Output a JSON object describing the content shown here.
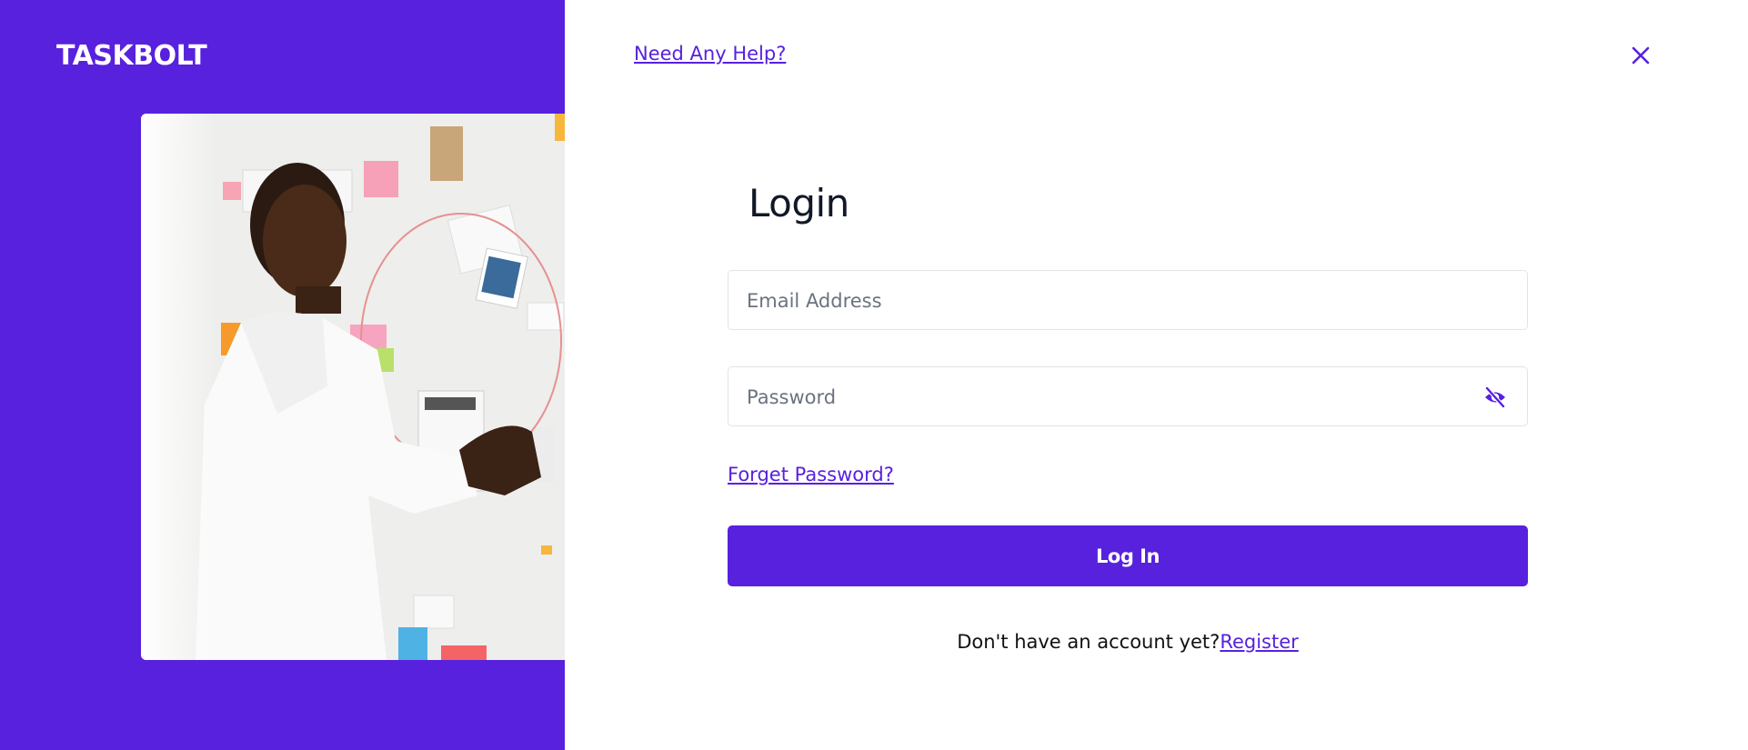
{
  "brand": {
    "logo_text": "TASKBOLT",
    "accent_color": "#5721de"
  },
  "header": {
    "help_link": "Need Any Help?",
    "close_icon": "close-icon"
  },
  "login": {
    "title": "Login",
    "email_placeholder": "Email Address",
    "email_value": "",
    "password_placeholder": "Password",
    "password_value": "",
    "password_toggle_icon": "eye-off-icon",
    "forgot_password": "Forget Password?",
    "submit_label": "Log In",
    "register_prompt": "Don't have an account yet?",
    "register_link": "Register"
  },
  "hero": {
    "image_description_icon": "office-photo"
  }
}
